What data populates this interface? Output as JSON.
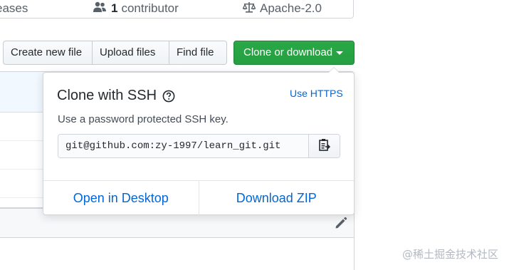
{
  "repo_stats": {
    "releases_label": "eases",
    "contributors_count": "1",
    "contributors_label": "contributor",
    "license_label": "Apache-2.0"
  },
  "file_nav": {
    "create_new_file": "Create new file",
    "upload_files": "Upload files",
    "find_file": "Find file",
    "clone_or_download": "Clone or download"
  },
  "clone_dropdown": {
    "title": "Clone with SSH",
    "switch_link": "Use HTTPS",
    "description": "Use a password protected SSH key.",
    "clone_url": "git@github.com:zy-1997/learn_git.git",
    "open_in_desktop": "Open in Desktop",
    "download_zip": "Download ZIP"
  },
  "watermark": "@稀土掘金技术社区",
  "colors": {
    "primary_green": "#28a745",
    "link_blue": "#0366d6",
    "border": "#d1d5da"
  },
  "icons": {
    "contributors": "people-icon",
    "license": "law-icon",
    "help": "question-icon",
    "copy": "clippy-icon",
    "edit": "pencil-icon"
  }
}
